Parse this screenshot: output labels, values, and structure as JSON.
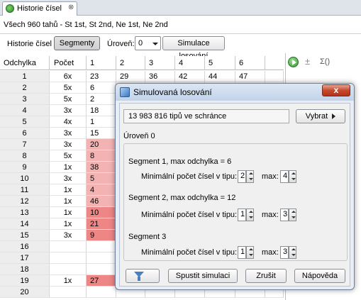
{
  "tab": {
    "title": "Historie čísel",
    "close": "⊗"
  },
  "info_line": "Všech 960 tahů - St 1st, St 2nd, Ne 1st, Ne 2nd",
  "filter": {
    "historie_label": "Historie čísel",
    "segmenty_button": "Segmenty",
    "uroven_label": "Úroveň:",
    "uroven_value": "0",
    "simulace_button": "Simulace losování"
  },
  "table": {
    "headers": [
      "Odchylka",
      "Počet",
      "1",
      "2",
      "3",
      "4",
      "5",
      "6"
    ],
    "rows": [
      {
        "odch": "1",
        "poc": "6x",
        "n": [
          "23",
          "29",
          "36",
          "42",
          "44",
          "47"
        ],
        "hl": ""
      },
      {
        "odch": "2",
        "poc": "5x",
        "n": [
          "6",
          "",
          "",
          "",
          "",
          ""
        ],
        "hl": ""
      },
      {
        "odch": "3",
        "poc": "5x",
        "n": [
          "2",
          "",
          "",
          "",
          "",
          ""
        ],
        "hl": ""
      },
      {
        "odch": "4",
        "poc": "3x",
        "n": [
          "18",
          "",
          "",
          "",
          "",
          ""
        ],
        "hl": ""
      },
      {
        "odch": "5",
        "poc": "4x",
        "n": [
          "1",
          "",
          "",
          "",
          "",
          ""
        ],
        "hl": ""
      },
      {
        "odch": "6",
        "poc": "3x",
        "n": [
          "15",
          "",
          "",
          "",
          "",
          ""
        ],
        "hl": ""
      },
      {
        "odch": "7",
        "poc": "3x",
        "n": [
          "20",
          "",
          "",
          "",
          "",
          ""
        ],
        "hl": "light"
      },
      {
        "odch": "8",
        "poc": "5x",
        "n": [
          "8",
          "",
          "",
          "",
          "",
          ""
        ],
        "hl": "light"
      },
      {
        "odch": "9",
        "poc": "1x",
        "n": [
          "38",
          "",
          "",
          "",
          "",
          ""
        ],
        "hl": "light"
      },
      {
        "odch": "10",
        "poc": "3x",
        "n": [
          "5",
          "",
          "",
          "",
          "",
          ""
        ],
        "hl": "light"
      },
      {
        "odch": "11",
        "poc": "1x",
        "n": [
          "4",
          "",
          "",
          "",
          "",
          ""
        ],
        "hl": "light"
      },
      {
        "odch": "12",
        "poc": "1x",
        "n": [
          "46",
          "",
          "",
          "",
          "",
          ""
        ],
        "hl": "light"
      },
      {
        "odch": "13",
        "poc": "1x",
        "n": [
          "10",
          "",
          "",
          "",
          "",
          ""
        ],
        "hl": "strong"
      },
      {
        "odch": "14",
        "poc": "1x",
        "n": [
          "21",
          "",
          "",
          "",
          "",
          ""
        ],
        "hl": "strong"
      },
      {
        "odch": "15",
        "poc": "3x",
        "n": [
          "9",
          "",
          "",
          "",
          "",
          ""
        ],
        "hl": "strong"
      },
      {
        "odch": "16",
        "poc": "",
        "n": [
          "",
          "",
          "",
          "",
          "",
          ""
        ],
        "hl": ""
      },
      {
        "odch": "17",
        "poc": "",
        "n": [
          "",
          "",
          "",
          "",
          "",
          ""
        ],
        "hl": ""
      },
      {
        "odch": "18",
        "poc": "",
        "n": [
          "",
          "",
          "",
          "",
          "",
          ""
        ],
        "hl": ""
      },
      {
        "odch": "19",
        "poc": "1x",
        "n": [
          "27",
          "",
          "",
          "",
          "",
          ""
        ],
        "hl": "strong"
      },
      {
        "odch": "20",
        "poc": "",
        "n": [
          "",
          "",
          "",
          "",
          "",
          ""
        ],
        "hl": ""
      }
    ]
  },
  "colors": {
    "light": "#f4b3b3",
    "strong": "#ee8686",
    "first_col": "#ededed"
  },
  "toolbar_icons": {
    "play": "play-icon",
    "plusminus": "±",
    "sigma": "Σ()"
  },
  "dialog": {
    "title": "Simulovaná losování",
    "close": "x",
    "tips": "13 983 816 tipů ve schránce",
    "vybrat_button": "Vybrat",
    "level_label": "Úroveň 0",
    "segments": [
      {
        "title": "Segment 1, max odchylka = 6",
        "min_label": "Minimální počet čísel v tipu:",
        "min_value": "2",
        "max_label": "max:",
        "max_value": "4"
      },
      {
        "title": "Segment 2, max odchylka = 12",
        "min_label": "Minimální počet čísel v tipu:",
        "min_value": "1",
        "max_label": "max:",
        "max_value": "3"
      },
      {
        "title": "Segment 3",
        "min_label": "Minimální počet čísel v tipu:",
        "min_value": "1",
        "max_label": "max:",
        "max_value": "3"
      }
    ],
    "buttons": {
      "spustit": "Spustit simulaci",
      "zrusit": "Zrušit",
      "napoveda": "Nápověda"
    }
  }
}
